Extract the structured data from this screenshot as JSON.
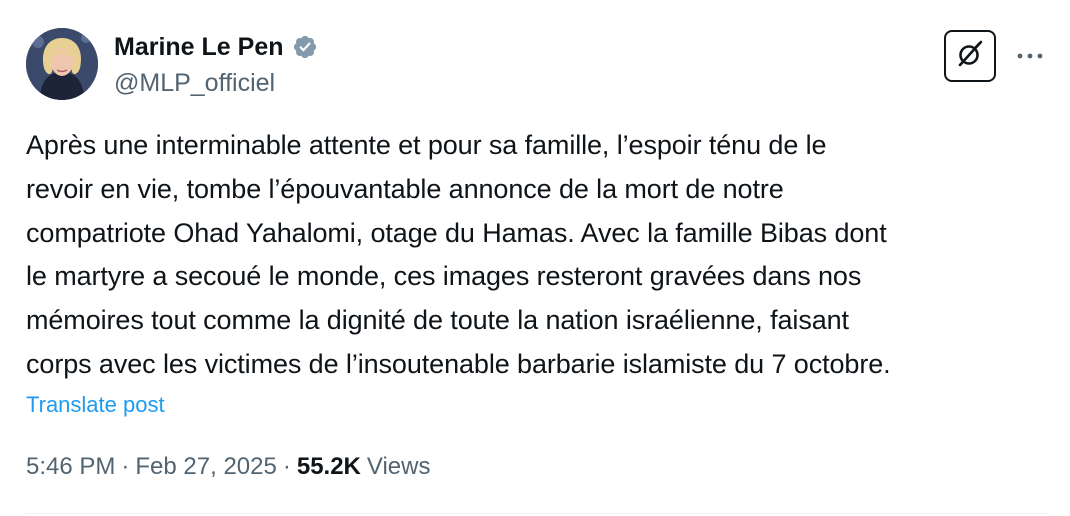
{
  "author": {
    "display_name": "Marine Le Pen",
    "handle": "@MLP_officiel",
    "verified": true,
    "verified_color": "#829aab"
  },
  "actions": {
    "grok_icon": "grok-icon",
    "more_icon": "more-horizontal-icon"
  },
  "post": {
    "text": "Après une interminable attente et pour sa famille, l’espoir ténu de le\nrevoir en vie, tombe l’épouvantable annonce de la mort de notre\ncompatriote Ohad Yahalomi, otage du Hamas. Avec la famille Bibas dont\nle martyre a secoué le monde, ces images resteront gravées dans nos\nmémoires tout comme la dignité de toute la nation israélienne, faisant\ncorps avec les victimes de l’insoutenable barbarie islamiste du 7 octobre.",
    "translate_label": "Translate post"
  },
  "meta": {
    "time": "5:46 PM",
    "separator": "·",
    "date": "Feb 27, 2025",
    "views_count": "55.2K",
    "views_label": "Views"
  },
  "colors": {
    "text_primary": "#0f1419",
    "text_secondary": "#536471",
    "link": "#1d9bf0"
  }
}
